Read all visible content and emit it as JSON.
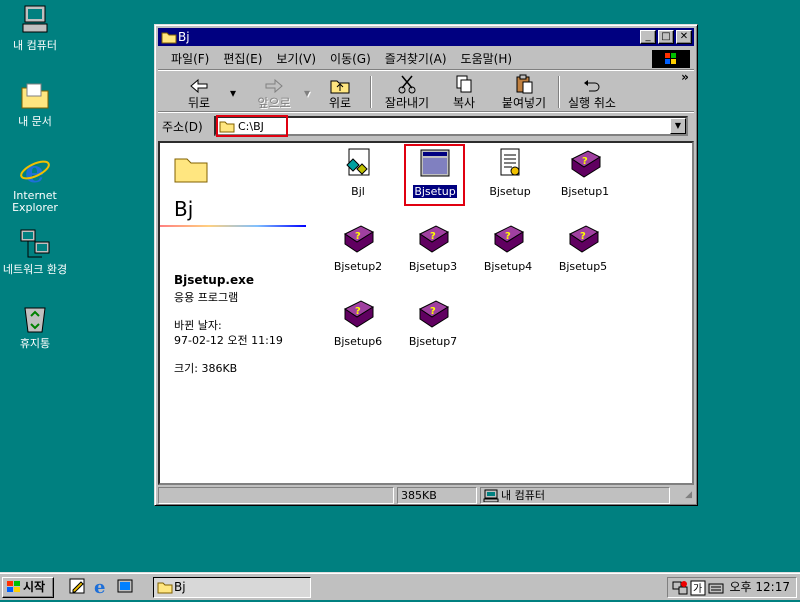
{
  "desktop": {
    "icons": [
      {
        "label": "내 컴퓨터"
      },
      {
        "label": "내 문서"
      },
      {
        "label": "Internet Explorer"
      },
      {
        "label": "네트워크 환경"
      },
      {
        "label": "휴지통"
      }
    ]
  },
  "window": {
    "title": "Bj",
    "menu": [
      "파일(F)",
      "편집(E)",
      "보기(V)",
      "이동(G)",
      "즐겨찾기(A)",
      "도움말(H)"
    ],
    "toolbar": {
      "back": "뒤로",
      "forward": "앞으로",
      "up": "위로",
      "cut": "잘라내기",
      "copy": "복사",
      "paste": "붙여넣기",
      "undo": "실행 취소"
    },
    "address": {
      "label": "주소(D)",
      "value": "C:\\BJ"
    },
    "left_pane": {
      "folder_title": "Bj",
      "filename": "Bjsetup.exe",
      "filetype": "응용 프로그램",
      "modified_label": "바뀐 날자:",
      "modified_value": "97-02-12 오전 11:19",
      "size": "크기: 386KB"
    },
    "files": [
      "Bjl",
      "Bjsetup",
      "Bjsetup",
      "Bjsetup1",
      "Bjsetup2",
      "Bjsetup3",
      "Bjsetup4",
      "Bjsetup5",
      "Bjsetup6",
      "Bjsetup7"
    ],
    "status": {
      "size": "385KB",
      "location": "내 컴퓨터"
    }
  },
  "taskbar": {
    "start": "시작",
    "task": "Bj",
    "clock": "오후 12:17"
  },
  "colors": {
    "desktop": "#008080",
    "titlebar": "#000080",
    "highlight_box": "#e00010"
  }
}
